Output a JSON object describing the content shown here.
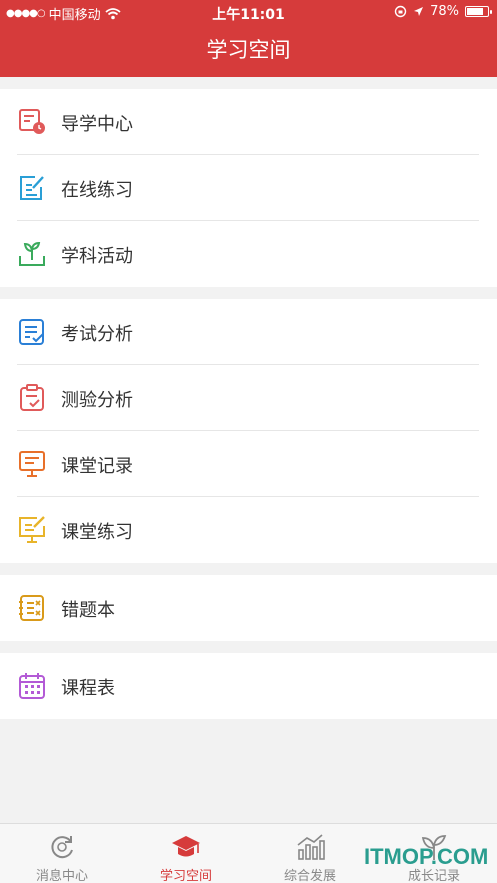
{
  "status_bar": {
    "carrier": "中国移动",
    "time": "上午11:01",
    "battery": "78%",
    "battery_level": 0.78
  },
  "header": {
    "title": "学习空间"
  },
  "groups": [
    {
      "items": [
        {
          "label": "导学中心",
          "icon": "certificate-icon",
          "color": "#e05a5a"
        },
        {
          "label": "在线练习",
          "icon": "edit-note-icon",
          "color": "#2a9fd6"
        },
        {
          "label": "学科活动",
          "icon": "sprout-icon",
          "color": "#3aaa5c"
        }
      ]
    },
    {
      "items": [
        {
          "label": "考试分析",
          "icon": "checklist-icon",
          "color": "#2a7fd6"
        },
        {
          "label": "测验分析",
          "icon": "clipboard-check-icon",
          "color": "#e05a5a"
        },
        {
          "label": "课堂记录",
          "icon": "presentation-icon",
          "color": "#e8702a"
        },
        {
          "label": "课堂练习",
          "icon": "presentation-edit-icon",
          "color": "#e8b42a"
        }
      ]
    },
    {
      "items": [
        {
          "label": "错题本",
          "icon": "notebook-icon",
          "color": "#d99a1a"
        }
      ]
    },
    {
      "items": [
        {
          "label": "课程表",
          "icon": "calendar-icon",
          "color": "#b35ad6"
        }
      ]
    }
  ],
  "tabs": [
    {
      "label": "消息中心",
      "icon": "refresh-chat-icon",
      "active": false
    },
    {
      "label": "学习空间",
      "icon": "graduation-cap-icon",
      "active": true
    },
    {
      "label": "综合发展",
      "icon": "bar-chart-icon",
      "active": false
    },
    {
      "label": "成长记录",
      "icon": "sprout-icon",
      "active": false
    }
  ],
  "watermark": "ITMOP.COM",
  "colors": {
    "header_bg": "#d63b3b",
    "active_tab": "#d63b3b",
    "inactive_tab": "#888888"
  }
}
